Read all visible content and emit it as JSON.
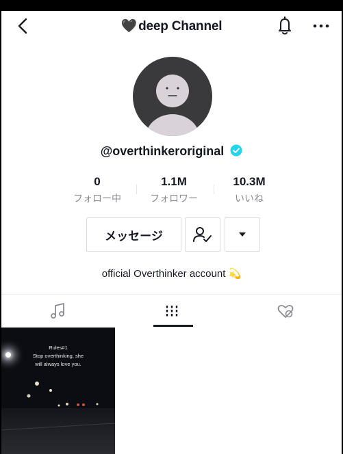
{
  "header": {
    "title": "deep Channel",
    "title_prefix": "🖤"
  },
  "profile": {
    "username": "@overthinkeroriginal",
    "verified": true,
    "stats": [
      {
        "value": "0",
        "label": "フォロー中"
      },
      {
        "value": "1.1M",
        "label": "フォロワー"
      },
      {
        "value": "10.3M",
        "label": "いいね"
      }
    ],
    "message_button": "メッセージ",
    "bio": "official Overthinker account",
    "bio_emoji": "💫"
  },
  "tabs": [
    {
      "name": "music",
      "active": false
    },
    {
      "name": "videos",
      "active": true
    },
    {
      "name": "liked",
      "active": false
    }
  ],
  "videos": [
    {
      "caption_line1": "Rules#1",
      "caption_line2": "Stop overthinking. she",
      "caption_line3": "will always love you."
    }
  ],
  "colors": {
    "verified": "#20d5ec",
    "text": "#161823",
    "muted": "#8a8b91"
  }
}
